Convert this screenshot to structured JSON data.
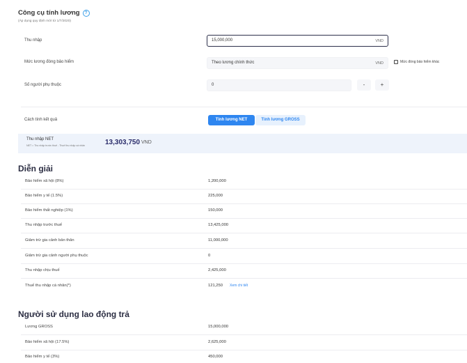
{
  "header": {
    "title": "Công cụ tính lương",
    "help_icon": "?",
    "subtitle": "(Áp dụng quy định mới từ 1/7/2020)"
  },
  "form": {
    "income": {
      "label": "Thu nhập",
      "value": "15,000,000",
      "unit": "VND"
    },
    "insurance": {
      "label": "Mức lương đóng bảo hiểm",
      "value": "Theo lương chính thức",
      "unit": "VND",
      "other_checkbox_label": "Mức đóng bảo hiểm khác",
      "other_checked": false
    },
    "dependents": {
      "label": "Số người phụ thuộc",
      "value": "0",
      "minus": "-",
      "plus": "+"
    },
    "result_method": {
      "label": "Cách tính kết quả",
      "net_button": "Tính lương NET",
      "gross_button": "Tính lương GROSS",
      "selected": "net"
    }
  },
  "net_result": {
    "label": "Thu nhập NET",
    "formula": "NET = Thu nhập trước thuế - Thuế thu nhập cá nhân",
    "amount": "13,303,750",
    "unit": "VND"
  },
  "explanation": {
    "heading": "Diễn giải",
    "rows": [
      {
        "label": "Bảo hiểm xã hội (8%)",
        "value": "1,200,000"
      },
      {
        "label": "Bảo hiểm y tế (1.5%)",
        "value": "225,000"
      },
      {
        "label": "Bảo hiểm thất nghiệp (1%)",
        "value": "150,000"
      },
      {
        "label": "Thu nhập trước thuế",
        "value": "13,425,000"
      },
      {
        "label": "Giảm trừ gia cảnh bản thân",
        "value": "11,000,000"
      },
      {
        "label": "Giảm trừ gia cảnh người phụ thuộc",
        "value": "0"
      },
      {
        "label": "Thu nhập chịu thuế",
        "value": "2,425,000"
      },
      {
        "label": "Thuế thu nhập cá nhân(*)",
        "value": "121,250",
        "link": "Xem chi tiết"
      }
    ]
  },
  "employer": {
    "heading": "Người sử dụng lao động trả",
    "rows": [
      {
        "label": "Lương GROSS",
        "value": "15,000,000"
      },
      {
        "label": "Bảo hiểm xã hội (17.5%)",
        "value": "2,625,000"
      },
      {
        "label": "Bảo hiểm y tế (3%)",
        "value": "450,000"
      }
    ]
  },
  "colors": {
    "accent": "#2e86f0",
    "accent_light": "#e7f1fd",
    "net_bg": "#eef3fb",
    "net_amount": "#2b2d6b"
  }
}
